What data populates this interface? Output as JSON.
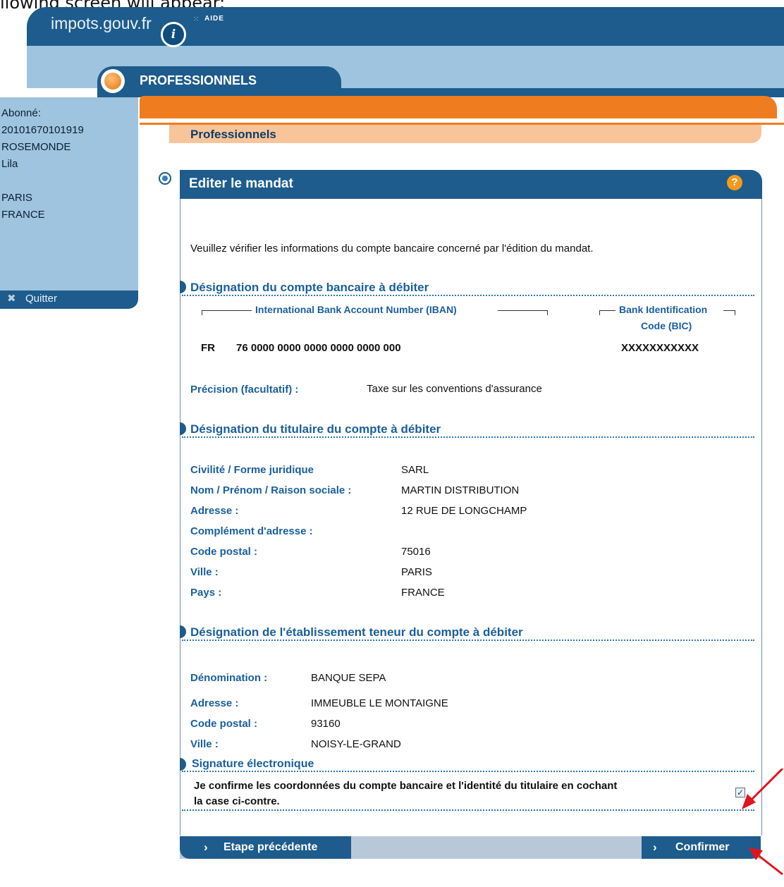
{
  "caption": "llowing screen will appear:",
  "header": {
    "site_title": "impots.gouv.fr",
    "info_icon_glyph": "i",
    "aide_label": "AIDE",
    "section_tab": "PROFESSIONNELS",
    "breadcrumb": "Professionnels"
  },
  "sidebar": {
    "lines": [
      "Abonné:",
      "20101670101919",
      "ROSEMONDE",
      "Lila",
      "",
      "PARIS",
      "FRANCE"
    ],
    "quit_label": "Quitter"
  },
  "panel": {
    "title": "Editer le mandat",
    "help_glyph": "?",
    "intro": "Veuillez vérifier les informations du compte bancaire concerné par l'édition du mandat."
  },
  "bank_account": {
    "section_title": "Désignation du compte bancaire à débiter",
    "iban_header": "International Bank Account Number  (IBAN)",
    "bic_header_line1": "Bank Identification",
    "bic_header_line2": "Code (BIC)",
    "iban_country": "FR",
    "iban_value": "76  0000 0000 0000 0000 0000 000",
    "bic_value": "XXXXXXXXXXX",
    "precision_label": "Précision (facultatif) :",
    "precision_value": "Taxe sur les conventions d'assurance"
  },
  "holder": {
    "section_title": "Désignation du titulaire du compte à débiter",
    "rows": [
      {
        "label": "Civilité / Forme juridique",
        "value": "SARL"
      },
      {
        "label": "Nom / Prénom / Raison sociale :",
        "value": "MARTIN DISTRIBUTION"
      },
      {
        "label": "Adresse :",
        "value": "12 RUE DE LONGCHAMP"
      },
      {
        "label": "Complément d'adresse :",
        "value": ""
      },
      {
        "label": "Code postal :",
        "value": "75016"
      },
      {
        "label": "Ville :",
        "value": "PARIS"
      },
      {
        "label": "Pays :",
        "value": "FRANCE"
      }
    ]
  },
  "bank": {
    "section_title": "Désignation de l'établissement teneur du compte à débiter",
    "rows": [
      {
        "label": "Dénomination :",
        "value": "BANQUE SEPA"
      },
      {
        "label": "Adresse :",
        "value": "IMMEUBLE LE MONTAIGNE"
      },
      {
        "label": "Code postal :",
        "value": "93160"
      },
      {
        "label": "Ville :",
        "value": "NOISY-LE-GRAND"
      }
    ]
  },
  "signature": {
    "section_title": "Signature électronique",
    "confirm_line1": "Je confirme les coordonnées du compte bancaire et l'identité du titulaire en cochant",
    "confirm_line2": "la case ci-contre.",
    "checkbox_checked": true,
    "check_glyph": "✓"
  },
  "buttons": {
    "prev_label": "Etape précédente",
    "confirm_label": "Confirmer",
    "chevron_glyph": "›"
  },
  "colors": {
    "header_blue": "#1d5c8c",
    "light_blue": "#9fc4df",
    "orange": "#ef7d1f",
    "label_blue": "#1a5f9c",
    "annotation_red": "#e0141e"
  }
}
